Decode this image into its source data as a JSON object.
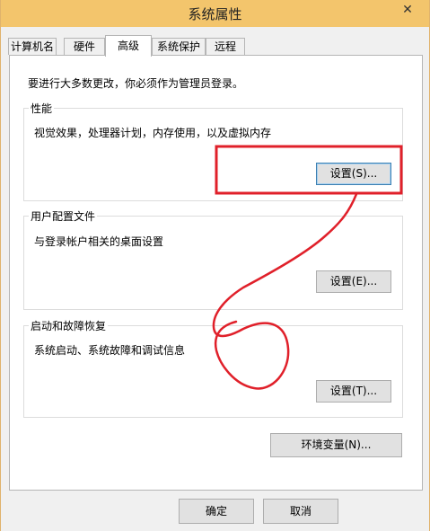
{
  "window": {
    "title": "系统属性",
    "close_glyph": "✕"
  },
  "tabs": [
    {
      "label": "计算机名",
      "active": false
    },
    {
      "label": "硬件",
      "active": false
    },
    {
      "label": "高级",
      "active": true
    },
    {
      "label": "系统保护",
      "active": false
    },
    {
      "label": "远程",
      "active": false
    }
  ],
  "advanced": {
    "admin_note": "要进行大多数更改，你必须作为管理员登录。",
    "performance": {
      "title": "性能",
      "description": "视觉效果，处理器计划，内存使用，以及虚拟内存",
      "button": "设置(S)..."
    },
    "user_profiles": {
      "title": "用户配置文件",
      "description": "与登录帐户相关的桌面设置",
      "button": "设置(E)..."
    },
    "startup_recovery": {
      "title": "启动和故障恢复",
      "description": "系统启动、系统故障和调试信息",
      "button": "设置(T)..."
    },
    "env_button": "环境变量(N)..."
  },
  "footer": {
    "ok": "确定",
    "cancel": "取消"
  },
  "colors": {
    "titlebar": "#f3c56c",
    "annotation_red": "#e0202a",
    "panel_bg": "#ffffff",
    "window_bg": "#f0f0f0"
  }
}
